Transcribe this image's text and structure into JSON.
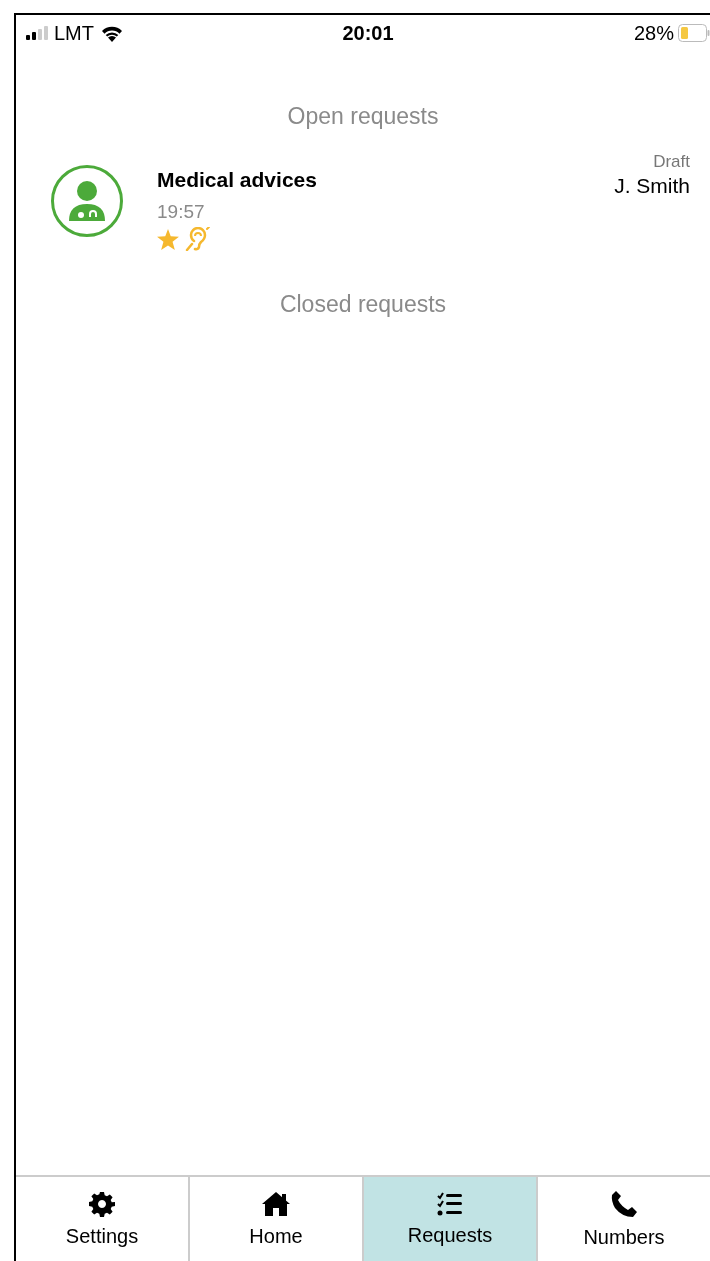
{
  "status_bar": {
    "carrier": "LMT",
    "time": "20:01",
    "battery": "28%"
  },
  "open_section": {
    "title": "Open requests",
    "requests": [
      {
        "title": "Medical advices",
        "time": "19:57",
        "status": "Draft",
        "person": "J. Smith",
        "flags": [
          {
            "kind": "star"
          },
          {
            "kind": "ear"
          }
        ]
      }
    ]
  },
  "closed_section": {
    "title": "Closed requests"
  },
  "tabs": [
    {
      "label": "Settings",
      "kind": "settings",
      "selected": false
    },
    {
      "label": "Home",
      "kind": "home",
      "selected": false
    },
    {
      "label": "Requests",
      "kind": "requests",
      "selected": true
    },
    {
      "label": "Numbers",
      "kind": "numbers",
      "selected": false
    }
  ]
}
